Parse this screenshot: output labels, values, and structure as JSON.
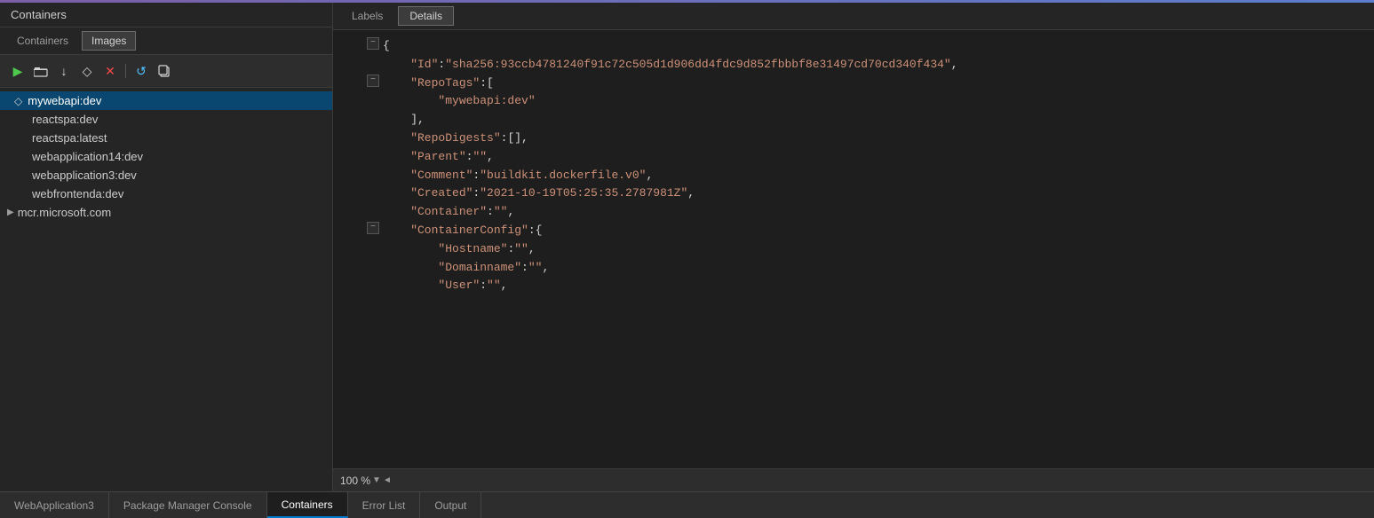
{
  "app": {
    "title": "Containers",
    "accent_color": "#7b5ea7"
  },
  "left_panel": {
    "title": "Containers",
    "tabs": [
      {
        "id": "containers",
        "label": "Containers",
        "active": false
      },
      {
        "id": "images",
        "label": "Images",
        "active": true
      }
    ],
    "toolbar": {
      "buttons": [
        {
          "id": "play",
          "symbol": "▶",
          "class": "green",
          "title": "Run"
        },
        {
          "id": "folder",
          "symbol": "🗀",
          "class": "",
          "title": "Open"
        },
        {
          "id": "download",
          "symbol": "↓",
          "class": "",
          "title": "Pull"
        },
        {
          "id": "tag",
          "symbol": "◇",
          "class": "",
          "title": "Tag"
        },
        {
          "id": "delete",
          "symbol": "✕",
          "class": "red",
          "title": "Delete"
        },
        {
          "id": "refresh",
          "symbol": "↺",
          "class": "cyan",
          "title": "Refresh"
        },
        {
          "id": "copy",
          "symbol": "⿻",
          "class": "",
          "title": "Copy"
        }
      ]
    },
    "images": [
      {
        "id": "mywebapi-dev",
        "label": "mywebapi:dev",
        "selected": true,
        "has_icon": true
      },
      {
        "id": "reactspa-dev",
        "label": "reactspa:dev",
        "selected": false,
        "has_icon": false
      },
      {
        "id": "reactspa-latest",
        "label": "reactspa:latest",
        "selected": false,
        "has_icon": false
      },
      {
        "id": "webapplication14-dev",
        "label": "webapplication14:dev",
        "selected": false,
        "has_icon": false
      },
      {
        "id": "webapplication3-dev",
        "label": "webapplication3:dev",
        "selected": false,
        "has_icon": false
      },
      {
        "id": "webfrontenda-dev",
        "label": "webfrontenda:dev",
        "selected": false,
        "has_icon": false
      }
    ],
    "expandable_items": [
      {
        "id": "mcr-microsoft",
        "label": "mcr.microsoft.com",
        "expanded": false
      }
    ]
  },
  "right_panel": {
    "tabs": [
      {
        "id": "labels",
        "label": "Labels",
        "active": false
      },
      {
        "id": "details",
        "label": "Details",
        "active": true
      }
    ],
    "json_lines": [
      {
        "indent": 0,
        "collapsible": true,
        "collapsed": false,
        "content": "{"
      },
      {
        "indent": 1,
        "collapsible": false,
        "content": "\"Id\": \"sha256:93ccb4781240f91c72c505d1d906dd4fdc9d852fbbbf8e31497cd70cd340f434\","
      },
      {
        "indent": 1,
        "collapsible": true,
        "collapsed": false,
        "content": "\"RepoTags\": ["
      },
      {
        "indent": 2,
        "collapsible": false,
        "content": "\"mywebapi:dev\""
      },
      {
        "indent": 1,
        "collapsible": false,
        "content": "],"
      },
      {
        "indent": 1,
        "collapsible": false,
        "content": "\"RepoDigests\": [],"
      },
      {
        "indent": 1,
        "collapsible": false,
        "content": "\"Parent\": \"\","
      },
      {
        "indent": 1,
        "collapsible": false,
        "content": "\"Comment\": \"buildkit.dockerfile.v0\","
      },
      {
        "indent": 1,
        "collapsible": false,
        "content": "\"Created\": \"2021-10-19T05:25:35.2787981Z\","
      },
      {
        "indent": 1,
        "collapsible": false,
        "content": "\"Container\": \"\","
      },
      {
        "indent": 1,
        "collapsible": true,
        "collapsed": false,
        "content": "\"ContainerConfig\": {"
      },
      {
        "indent": 2,
        "collapsible": false,
        "content": "\"Hostname\": \"\","
      },
      {
        "indent": 2,
        "collapsible": false,
        "content": "\"Domainname\": \"\","
      },
      {
        "indent": 2,
        "collapsible": false,
        "content": "\"User\": \"\","
      }
    ],
    "zoom": {
      "level": "100 %",
      "scroll_left": "◄"
    }
  },
  "bottom_tabs": [
    {
      "id": "webapplication3",
      "label": "WebApplication3",
      "active": false
    },
    {
      "id": "package-manager",
      "label": "Package Manager Console",
      "active": false
    },
    {
      "id": "containers",
      "label": "Containers",
      "active": true
    },
    {
      "id": "error-list",
      "label": "Error List",
      "active": false
    },
    {
      "id": "output",
      "label": "Output",
      "active": false
    }
  ]
}
